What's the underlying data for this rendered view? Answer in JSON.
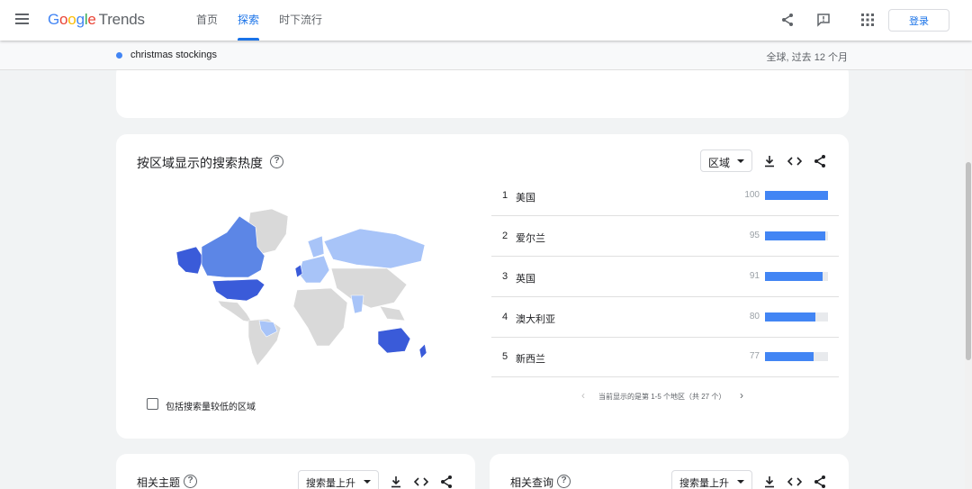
{
  "header": {
    "logo_google": [
      "G",
      "o",
      "o",
      "g",
      "l",
      "e"
    ],
    "logo_trends": "Trends",
    "nav": [
      "首页",
      "探索",
      "时下流行"
    ],
    "login": "登录"
  },
  "subbar": {
    "term": "christmas stockings",
    "scope": "全球, 过去 12 个月"
  },
  "region_card": {
    "title": "按区域显示的搜索热度",
    "help": "?",
    "select_value": "区域",
    "rows": [
      {
        "rank": "1",
        "name": "美国",
        "value": 100
      },
      {
        "rank": "2",
        "name": "爱尔兰",
        "value": 95
      },
      {
        "rank": "3",
        "name": "英国",
        "value": 91
      },
      {
        "rank": "4",
        "name": "澳大利亚",
        "value": 80
      },
      {
        "rank": "5",
        "name": "新西兰",
        "value": 77
      }
    ],
    "pager_text": "当前显示的是第 1-5 个地区（共 27 个）",
    "checkbox_label": "包括搜索量较低的区域"
  },
  "topics_card": {
    "title": "相关主题",
    "select_value": "搜索量上升"
  },
  "queries_card": {
    "title": "相关查询",
    "select_value": "搜索量上升"
  },
  "colors": {
    "accent": "#1a73e8",
    "bar": "#4285f4",
    "map_high": "#3a5bd9",
    "map_mid": "#5c86e6",
    "map_low": "#a8c4f8",
    "map_none": "#d9d9d9"
  }
}
